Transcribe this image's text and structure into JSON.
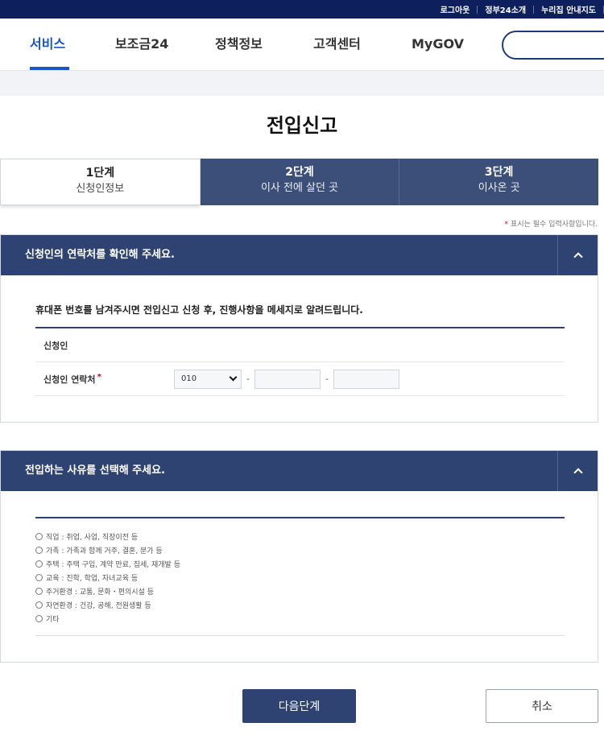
{
  "util_bar": {
    "links": [
      "로그아웃",
      "정부24소개",
      "누리집 안내지도"
    ]
  },
  "gnb": {
    "items": [
      {
        "label": "서비스",
        "active": true
      },
      {
        "label": "보조금24",
        "active": false
      },
      {
        "label": "정책정보",
        "active": false
      },
      {
        "label": "고객센터",
        "active": false
      },
      {
        "label": "MyGOV",
        "active": false
      }
    ],
    "search_placeholder": ""
  },
  "page_title": "전입신고",
  "steps": [
    {
      "num": "1단계",
      "name": "신청인정보",
      "active": true
    },
    {
      "num": "2단계",
      "name": "이사 전에 살던 곳",
      "active": false
    },
    {
      "num": "3단계",
      "name": "이사온 곳",
      "active": false
    }
  ],
  "required_note": "표시는 필수 입력사항입니다.",
  "contact_section": {
    "title": "신청인의 연락처를 확인해 주세요.",
    "intro": "휴대폰 번호를 남겨주시면 전입신고 신청 후, 진행사항을 메세지로 알려드립니다.",
    "applicant_label": "신청인",
    "applicant_value": "",
    "phone_label": "신청인 연락처",
    "phone_prefix": "010",
    "phone_middle": "",
    "phone_last": ""
  },
  "reason_section": {
    "title": "전입하는 사유를 선택해 주세요.",
    "options": [
      "직업 : 취업, 사업, 직장이전 등",
      "가족 : 가족과 함께 거주, 결혼, 분가 등",
      "주택 : 주택 구입, 계약 만료, 집세, 재개발 등",
      "교육 : 진학, 학업, 자녀교육 등",
      "주거환경 : 교통, 문화・편의시설 등",
      "자연환경 : 건강, 공해, 전원생활 등",
      "기타"
    ]
  },
  "buttons": {
    "next": "다음단계",
    "cancel": "취소"
  },
  "colors": {
    "navy": "#2f4372",
    "accent_blue": "#1a56c4",
    "required_red": "#d0021b"
  }
}
